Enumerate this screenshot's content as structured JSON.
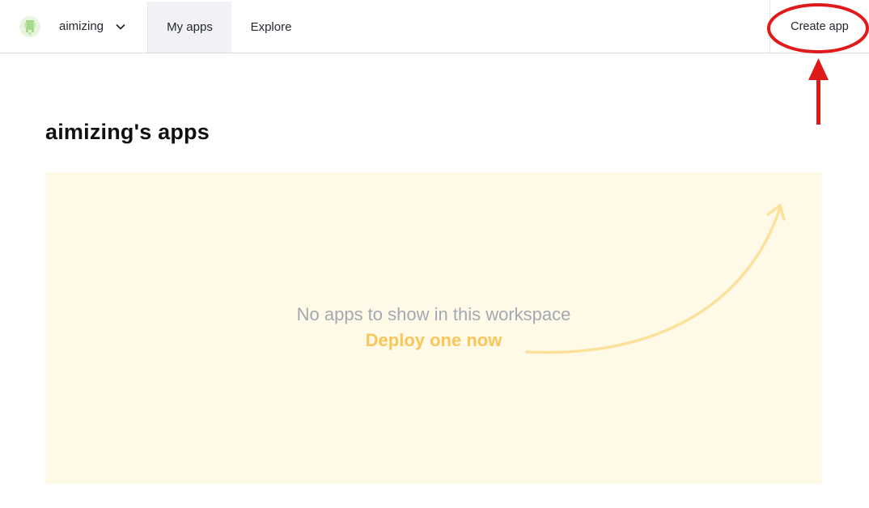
{
  "header": {
    "workspace": {
      "name": "aimizing",
      "avatar_icon": "workspace-avatar-icon",
      "chevron_icon": "chevron-down-icon"
    },
    "tabs": [
      {
        "label": "My apps",
        "active": true
      },
      {
        "label": "Explore",
        "active": false
      }
    ],
    "create_button": "Create app"
  },
  "main": {
    "title": "aimizing's apps",
    "empty_state": {
      "message": "No apps to show in this workspace",
      "link": "Deploy one now"
    }
  },
  "colors": {
    "accent_link": "#fbc659",
    "empty_bg": "#fff9e8",
    "annotation_red": "#e0191b",
    "active_tab_bg": "#f0f2f6"
  }
}
